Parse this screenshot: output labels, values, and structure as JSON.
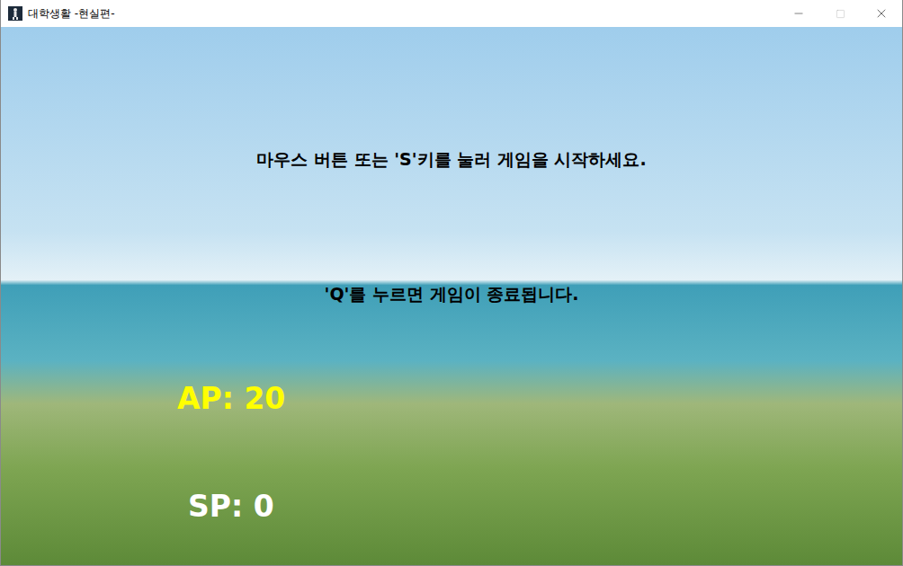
{
  "window": {
    "title": "대학생활 -현실편-"
  },
  "messages": [
    "마우스 버튼 또는 'S'키를 눌러 게임을 시작하세요.",
    "'Q'를 누르면 게임이 종료됩니다."
  ],
  "stats": [
    {
      "label": "AP: 20",
      "color": "#ffff00"
    },
    {
      "label": "SP: 0",
      "color": "#ffffff"
    }
  ]
}
